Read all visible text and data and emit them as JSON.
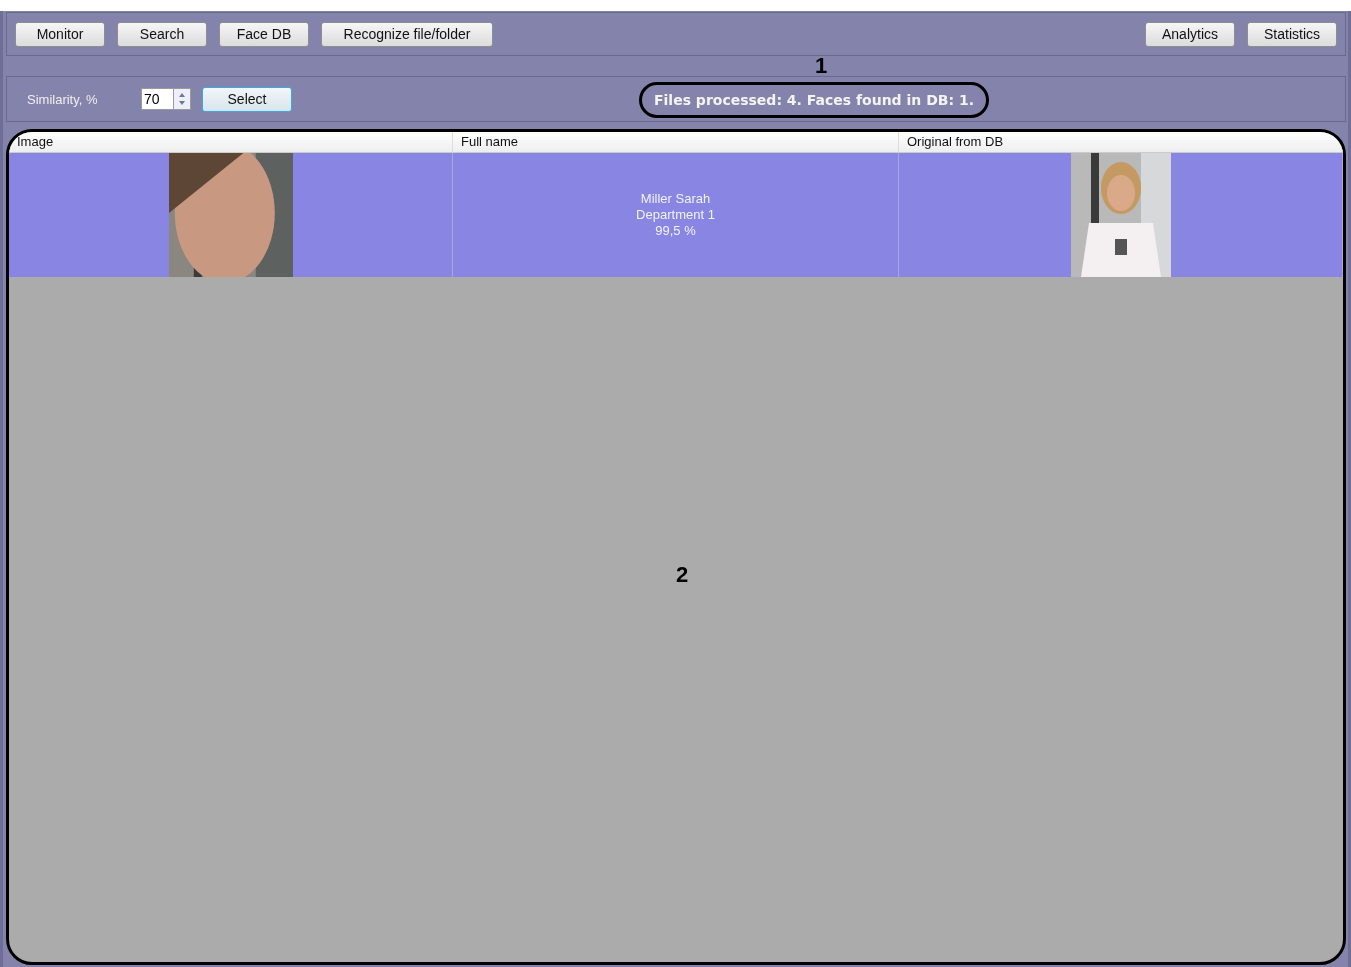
{
  "toolbar": {
    "left_buttons": [
      "Monitor",
      "Search",
      "Face DB",
      "Recognize file/folder"
    ],
    "right_buttons": [
      "Analytics",
      "Statistics"
    ]
  },
  "filter": {
    "similarity_label": "Similarity, %",
    "similarity_value": "70",
    "select_button": "Select",
    "status": "Files processed: 4. Faces found in DB: 1."
  },
  "callouts": [
    "1",
    "2"
  ],
  "table": {
    "columns": [
      "Image",
      "Full name",
      "Original from DB"
    ],
    "rows": [
      {
        "selected": true,
        "full_name": [
          "Miller Sarah",
          "Department 1",
          "99,5 %"
        ]
      }
    ]
  }
}
